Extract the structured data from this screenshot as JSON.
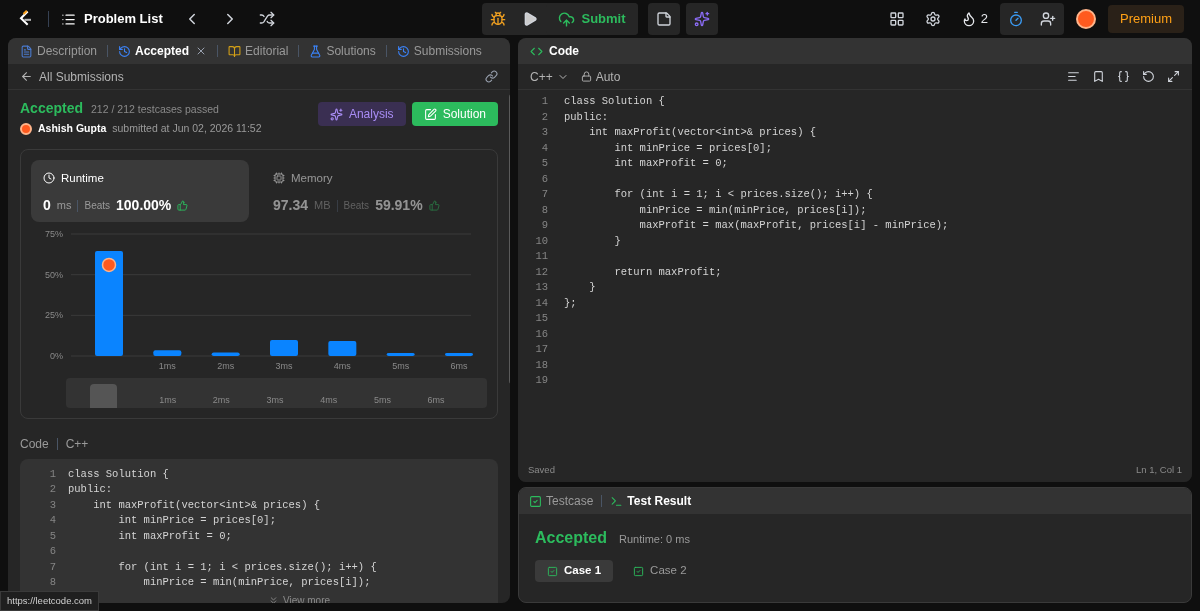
{
  "nav": {
    "problem_list": "Problem List",
    "submit": "Submit",
    "streak": "2",
    "premium": "Premium"
  },
  "left_tabs": [
    {
      "label": "Description",
      "kind": "description",
      "selected": false,
      "closable": false
    },
    {
      "label": "Accepted",
      "kind": "history",
      "selected": true,
      "closable": true
    },
    {
      "label": "Editorial",
      "kind": "editorial",
      "selected": false,
      "closable": false
    },
    {
      "label": "Solutions",
      "kind": "solutions",
      "selected": false,
      "closable": false
    },
    {
      "label": "Submissions",
      "kind": "history",
      "selected": false,
      "closable": false
    }
  ],
  "back_link": "All Submissions",
  "submission": {
    "status": "Accepted",
    "passed": "212 / 212 testcases passed",
    "author": "Ashish Gupta",
    "submitted": "submitted at Jun 02, 2026 11:52",
    "analysis": "Analysis",
    "solution": "Solution"
  },
  "stats": [
    {
      "kind": "runtime",
      "label": "Runtime",
      "value": "0",
      "unit": "ms",
      "beats_label": "Beats",
      "beats": "100.00%",
      "selected": true
    },
    {
      "kind": "memory",
      "label": "Memory",
      "value": "97.34",
      "unit": "MB",
      "beats_label": "Beats",
      "beats": "59.91%",
      "selected": false
    }
  ],
  "chart_data": {
    "type": "bar",
    "categories": [
      null,
      "1ms",
      "2ms",
      "3ms",
      "4ms",
      "5ms",
      "6ms"
    ],
    "values": [
      64.6,
      3.5,
      2.2,
      9.8,
      9.2,
      1.8,
      1.8
    ],
    "ylim": [
      0,
      75
    ],
    "yticks": [
      {
        "value": 0,
        "label": "0%"
      },
      {
        "value": 25,
        "label": "25%"
      },
      {
        "value": 50,
        "label": "50%"
      },
      {
        "value": 75,
        "label": "75%"
      }
    ]
  },
  "overview_labels": [
    "1ms",
    "2ms",
    "3ms",
    "4ms",
    "5ms",
    "6ms"
  ],
  "code_section": {
    "label": "Code",
    "language": "C++",
    "view_more": "View more"
  },
  "submitted_code": [
    {
      "n": "1",
      "text": "class Solution {"
    },
    {
      "n": "2",
      "text": "public:"
    },
    {
      "n": "3",
      "text": "    int maxProfit(vector<int>& prices) {"
    },
    {
      "n": "4",
      "text": "        int minPrice = prices[0];"
    },
    {
      "n": "5",
      "text": "        int maxProfit = 0;"
    },
    {
      "n": "6"
    },
    {
      "n": "7",
      "text": "        for (int i = 1; i < prices.size(); i++) {"
    },
    {
      "n": "8",
      "text": "            minPrice = min(minPrice, prices[i]);"
    }
  ],
  "editor": {
    "title": "Code",
    "language": "C++",
    "mode": "Auto",
    "status": "Saved",
    "cursor": "Ln 1, Col 1",
    "lines": [
      {
        "n": "1",
        "text": "class Solution {"
      },
      {
        "n": "2",
        "text": "public:"
      },
      {
        "n": "3",
        "text": "    int maxProfit(vector<int>& prices) {"
      },
      {
        "n": "4",
        "text": "        int minPrice = prices[0];"
      },
      {
        "n": "5",
        "text": "        int maxProfit = 0;"
      },
      {
        "n": "6"
      },
      {
        "n": "7",
        "text": "        for (int i = 1; i < prices.size(); i++) {"
      },
      {
        "n": "8",
        "text": "            minPrice = min(minPrice, prices[i]);"
      },
      {
        "n": "9",
        "text": "            maxProfit = max(maxProfit, prices[i] - minPrice);"
      },
      {
        "n": "10",
        "text": "        }"
      },
      {
        "n": "11"
      },
      {
        "n": "12",
        "text": "        return maxProfit;"
      },
      {
        "n": "13",
        "text": "    }"
      },
      {
        "n": "14",
        "text": "};"
      },
      {
        "n": "15"
      },
      {
        "n": "16"
      },
      {
        "n": "17"
      },
      {
        "n": "18"
      },
      {
        "n": "19"
      }
    ]
  },
  "result_tabs": [
    {
      "label": "Testcase",
      "kind": "testcase",
      "selected": false
    },
    {
      "label": "Test Result",
      "kind": "result",
      "selected": true
    }
  ],
  "result": {
    "status": "Accepted",
    "runtime": "Runtime: 0 ms",
    "cases": [
      {
        "label": "Case 1",
        "selected": true
      },
      {
        "label": "Case 2",
        "selected": false
      }
    ]
  },
  "status_url": "https://leetcode.com"
}
